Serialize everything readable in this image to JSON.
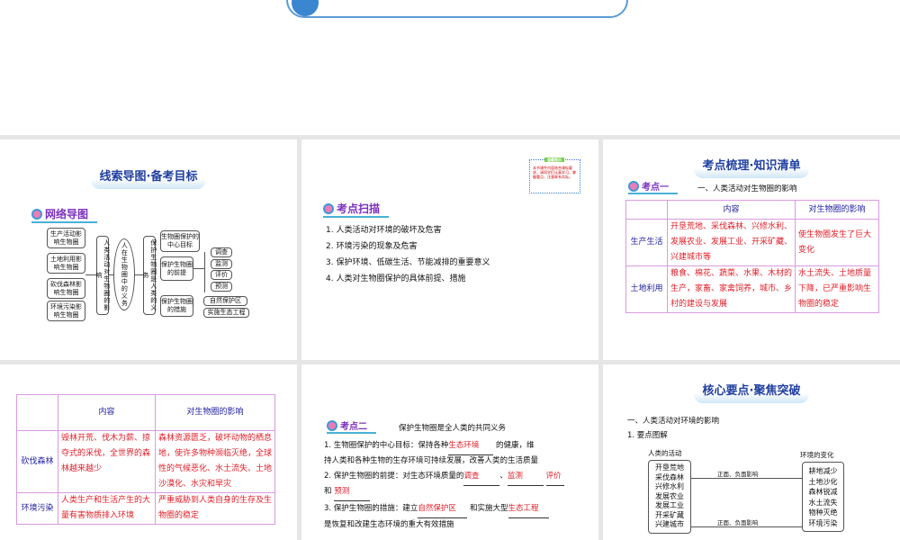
{
  "slides": [
    {
      "title": "线索导图·备考目标",
      "tag": "网络导图",
      "left_boxes": [
        "生产活动影响生物圈",
        "土地利用影响生物圈",
        "砍伐森林影响生物圈",
        "环境污染影响生物圈"
      ],
      "left_vertical": "人类活动对生物圈的影响",
      "center": "人在生物圈中的义务",
      "right_vertical": "保护生物圈是人类的义务",
      "right_boxes": [
        "生物圈保护的中心目标",
        "保护生物圈的前提",
        "保护生物圈的措施"
      ],
      "premise_items": [
        "调查",
        "监测",
        "评价",
        "预测"
      ],
      "measure_items": [
        "自然保护区",
        "实施生态工程"
      ]
    },
    {
      "tag": "考点扫描",
      "note_title": "温馨提示",
      "note_text": "本节课件内容结合课标要求，请同学们认真学习，掌握重点，注意联系实际。",
      "items": [
        "1. 人类活动对环境的破坏及危害",
        "2. 环境污染的现象及危害",
        "3. 保护环境、低碳生活、节能减排的重要意义",
        "4. 人类对生物圈保护的具体前提、措施"
      ]
    },
    {
      "title": "考点梳理·知识清单",
      "tag": "考点一",
      "heading": "一、人类活动对生物圈的影响",
      "col_headers": [
        "内容",
        "对生物圈的影响"
      ],
      "rows": [
        {
          "label": "生产生活",
          "content": "开垦荒地、采伐森林、兴修水利、发展农业、发展工业、开采矿藏、兴建城市等",
          "effect": "使生物圈发生了巨大变化"
        },
        {
          "label": "土地利用",
          "content": "粮食、棉花、蔬菜、水果、木材的生产，家畜、家禽饲养，城市、乡村的建设与发展",
          "effect": "水土流失、土地质量下降，已严重影响生物圈的稳定"
        }
      ]
    },
    {
      "col_headers": [
        "内容",
        "对生物圈的影响"
      ],
      "rows": [
        {
          "label": "砍伐森林",
          "content": "毁林开荒、伐木为薪、掠夺式的采伐，全世界的森林越来越少",
          "effect": "森林资源匮乏，破坏动物的栖息地，使许多物种濒临灭绝，全球性的气候恶化、水土流失、土地沙漠化、水灾和旱灾"
        },
        {
          "label": "环境污染",
          "content": "人类生产和生活产生的大量有害物质排入环境",
          "effect": "严重威胁到人类自身的生存及生物圈的稳定"
        }
      ]
    },
    {
      "tag": "考点二",
      "heading": "保护生物圈是全人类的共同义务",
      "l1a": "1. 生物圈保护的中心目标：保持各种",
      "f1": "生态环境",
      "l1b": "的健康，维",
      "l1c": "持人类和各种生物的生存环境可持续发展，改善人类的生活质量",
      "l2a": "2. 保护生物圈的前提：对生态环境质量的",
      "f2a": "调查",
      "f2b": "监测",
      "f2c": "评价",
      "and": "和",
      "f2d": "预测",
      "l3a": "3. 保护生物圈的措施：建立",
      "f3a": "自然保护区",
      "l3b": "和实施大型",
      "f3b": "生态工程",
      "l3c": "是恢复和改建生态环境的重大有效措施"
    },
    {
      "title": "核心要点·聚焦突破",
      "h1": "一、人类活动对环境的影响",
      "h2": "1. 要点图解",
      "left_label": "人类的活动",
      "right_label": "环境的变化",
      "activities": [
        "开垦荒地",
        "采伐森林",
        "兴修水利",
        "发展农业",
        "发展工业",
        "开采矿藏",
        "兴建城市"
      ],
      "changes": [
        "耕地减少",
        "土地沙化",
        "森林锐减",
        "水土流失",
        "物种灭绝",
        "环境污染"
      ],
      "arrow_label": "正面、负面影响"
    }
  ]
}
